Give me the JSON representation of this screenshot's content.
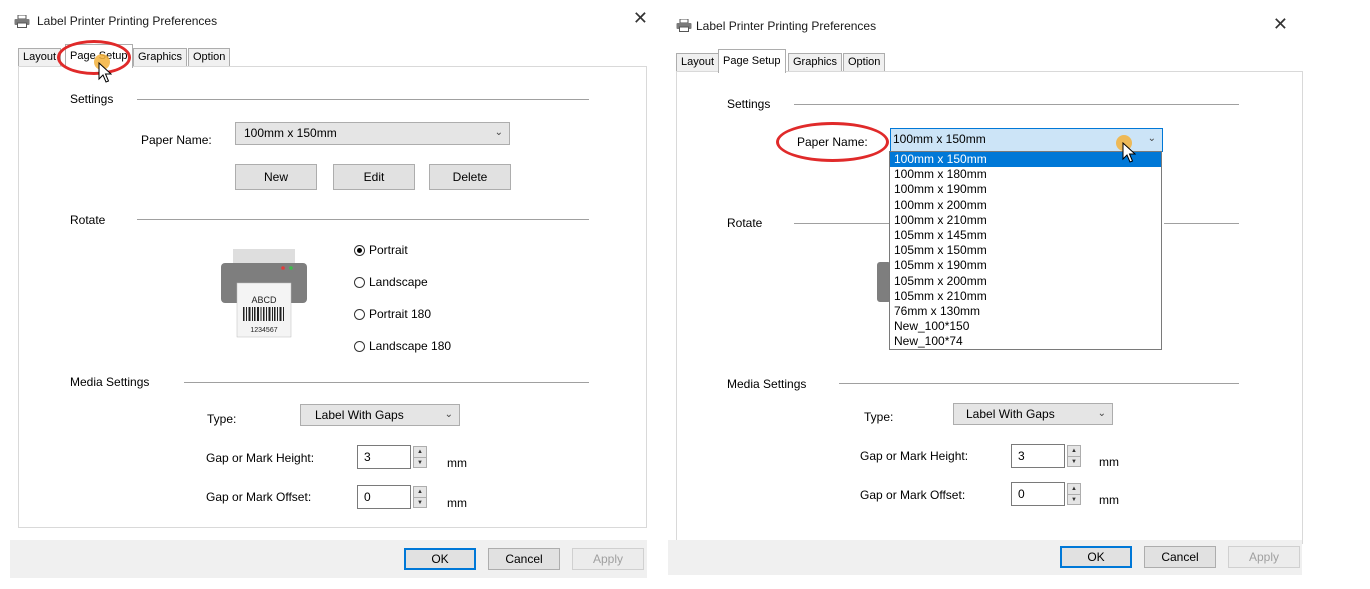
{
  "dialog1": {
    "title": "Label Printer Printing Preferences",
    "close_glyph": "✕",
    "tabs": [
      "Layout",
      "Page Setup",
      "Graphics",
      "Option"
    ],
    "active_tab": "Page Setup",
    "settings": {
      "label": "Settings",
      "paper_name_label": "Paper Name:",
      "paper_name_value": "100mm x 150mm",
      "new_label": "New",
      "edit_label": "Edit",
      "delete_label": "Delete"
    },
    "rotate": {
      "label": "Rotate",
      "options": [
        "Portrait",
        "Landscape",
        "Portrait 180",
        "Landscape 180"
      ],
      "selected": "Portrait",
      "illustration_text": "ABCD",
      "illustration_number": "1234567"
    },
    "media": {
      "label": "Media Settings",
      "type_label": "Type:",
      "type_value": "Label With Gaps",
      "gap_height_label": "Gap or Mark Height:",
      "gap_height_value": "3",
      "gap_offset_label": "Gap or Mark Offset:",
      "gap_offset_value": "0",
      "unit": "mm"
    },
    "footer": {
      "ok": "OK",
      "cancel": "Cancel",
      "apply": "Apply"
    }
  },
  "dialog2": {
    "title": "Label Printer Printing Preferences",
    "close_glyph": "✕",
    "tabs": [
      "Layout",
      "Page Setup",
      "Graphics",
      "Option"
    ],
    "active_tab": "Page Setup",
    "settings": {
      "label": "Settings",
      "paper_name_label": "Paper Name:",
      "paper_name_value": "100mm x 150mm"
    },
    "paper_list": [
      "100mm x 150mm",
      "100mm x 180mm",
      "100mm x 190mm",
      "100mm x 200mm",
      "100mm x 210mm",
      "105mm x 145mm",
      "105mm x 150mm",
      "105mm x 190mm",
      "105mm x 200mm",
      "105mm x 210mm",
      "76mm x 130mm",
      "New_100*150",
      "New_100*74"
    ],
    "paper_list_selected": "100mm x 150mm",
    "rotate": {
      "label": "Rotate"
    },
    "media": {
      "label": "Media Settings",
      "type_label": "Type:",
      "type_value": "Label With Gaps",
      "gap_height_label": "Gap or Mark Height:",
      "gap_height_value": "3",
      "gap_offset_label": "Gap or Mark Offset:",
      "gap_offset_value": "0",
      "unit": "mm"
    },
    "footer": {
      "ok": "OK",
      "cancel": "Cancel",
      "apply": "Apply"
    }
  },
  "colors": {
    "accent": "#0078d7",
    "highlight_ring": "#e02a2a",
    "click_marker": "#f3b13b",
    "footer_bg": "#f0f0f0"
  },
  "icons": [
    "printer-icon",
    "close-icon",
    "chevron-down-icon",
    "spin-up-icon",
    "spin-down-icon",
    "mouse-cursor-icon"
  ]
}
